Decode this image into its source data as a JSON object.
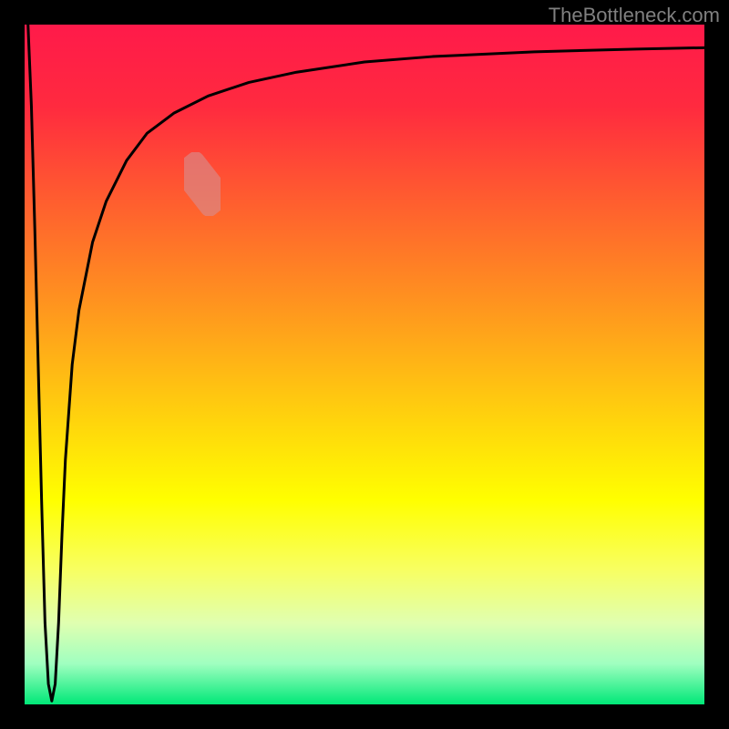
{
  "attribution": "TheBottleneck.com",
  "chart_data": {
    "type": "line",
    "title": "",
    "xlabel": "",
    "ylabel": "",
    "xlim": [
      0,
      100
    ],
    "ylim": [
      0,
      100
    ],
    "grid": false,
    "legend": false,
    "background_gradient": {
      "stops": [
        {
          "pos": 0.0,
          "color": "#ff1a4a"
        },
        {
          "pos": 0.12,
          "color": "#ff2a3f"
        },
        {
          "pos": 0.25,
          "color": "#ff5a30"
        },
        {
          "pos": 0.4,
          "color": "#ff9020"
        },
        {
          "pos": 0.55,
          "color": "#ffc810"
        },
        {
          "pos": 0.7,
          "color": "#ffff00"
        },
        {
          "pos": 0.8,
          "color": "#f8ff60"
        },
        {
          "pos": 0.88,
          "color": "#e0ffb0"
        },
        {
          "pos": 0.94,
          "color": "#a0ffc0"
        },
        {
          "pos": 1.0,
          "color": "#00e878"
        }
      ]
    },
    "series": [
      {
        "name": "bottleneck-curve",
        "x": [
          0.5,
          1.0,
          1.5,
          2.0,
          2.5,
          3.0,
          3.5,
          4.0,
          4.5,
          5.0,
          5.5,
          6.0,
          7.0,
          8.0,
          10.0,
          12.0,
          15.0,
          18.0,
          22.0,
          27.0,
          33.0,
          40.0,
          50.0,
          60.0,
          75.0,
          90.0,
          100.0
        ],
        "y": [
          100,
          88,
          70,
          50,
          30,
          12,
          3,
          0.5,
          3,
          12,
          25,
          36,
          50,
          58,
          68,
          74,
          80,
          84,
          87,
          89.5,
          91.5,
          93,
          94.5,
          95.3,
          96.0,
          96.4,
          96.6
        ]
      }
    ],
    "highlight": {
      "x_range": [
        23,
        29
      ],
      "color": "#d98a8a",
      "opacity": 0.65
    }
  }
}
